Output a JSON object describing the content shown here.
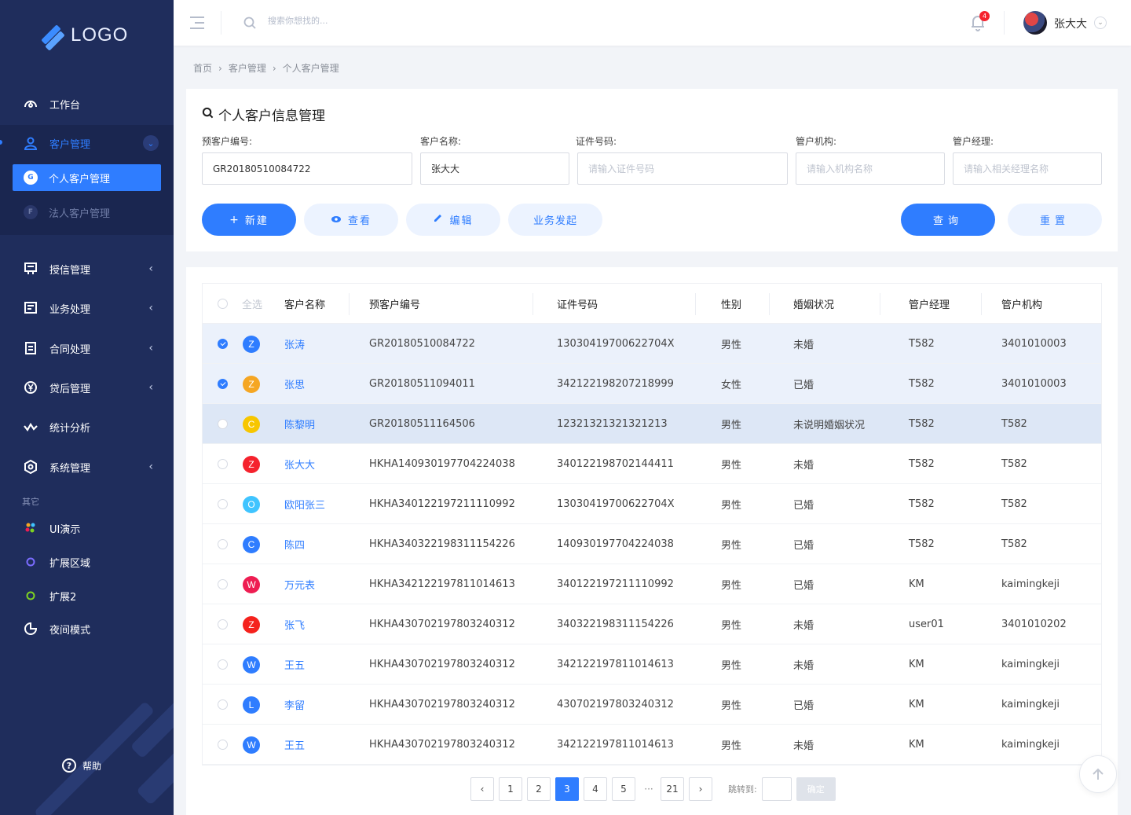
{
  "sidebar": {
    "logo": "LOGO",
    "menu": [
      {
        "label": "工作台",
        "icon": "dashboard-icon",
        "arrow": false
      },
      {
        "label": "客户管理",
        "icon": "user-icon",
        "arrow": "down"
      },
      {
        "label": "授信管理",
        "icon": "credit-icon",
        "arrow": "left"
      },
      {
        "label": "业务处理",
        "icon": "business-icon",
        "arrow": "left"
      },
      {
        "label": "合同处理",
        "icon": "contract-icon",
        "arrow": "left"
      },
      {
        "label": "贷后管理",
        "icon": "yen-icon",
        "arrow": "left"
      },
      {
        "label": "统计分析",
        "icon": "chart-icon",
        "arrow": false
      },
      {
        "label": "系统管理",
        "icon": "settings-icon",
        "arrow": "left"
      }
    ],
    "submenu": [
      {
        "badge": "G",
        "label": "个人客户管理",
        "active": true
      },
      {
        "badge": "F",
        "label": "法人客户管理",
        "active": false
      }
    ],
    "section_label": "其它",
    "other_items": [
      {
        "label": "UI演示",
        "icon": "palette-icon"
      },
      {
        "label": "扩展区域",
        "icon": "circle-icon-purple"
      },
      {
        "label": "扩展2",
        "icon": "circle-icon-green"
      },
      {
        "label": "夜间模式",
        "icon": "moon-icon"
      }
    ],
    "help": "帮助"
  },
  "topbar": {
    "search_placeholder": "搜索你想找的...",
    "notification_count": "4",
    "user_name": "张大大"
  },
  "breadcrumb": [
    "首页",
    "客户管理",
    "个人客户管理"
  ],
  "search_panel": {
    "title": "个人客户信息管理",
    "fields": [
      {
        "label": "预客户编号:",
        "value": "GR20180510084722",
        "placeholder": ""
      },
      {
        "label": "客户名称:",
        "value": "张大大",
        "placeholder": ""
      },
      {
        "label": "证件号码:",
        "value": "",
        "placeholder": "请输入证件号码"
      },
      {
        "label": "管户机构:",
        "value": "",
        "placeholder": "请输入机构名称"
      },
      {
        "label": "管户经理:",
        "value": "",
        "placeholder": "请输入相关经理名称"
      }
    ],
    "buttons": {
      "new": "新建",
      "view": "查看",
      "edit": "编辑",
      "business": "业务发起",
      "query": "查询",
      "reset": "重置"
    }
  },
  "table": {
    "columns": [
      "全选",
      "客户名称",
      "预客户编号",
      "证件号码",
      "性别",
      "婚姻状况",
      "管户经理",
      "管户机构"
    ],
    "rows": [
      {
        "checked": true,
        "state": "sel",
        "initial": "Z",
        "color": "#2f7dff",
        "name": "张涛",
        "pre_id": "GR20180510084722",
        "cert": "13030419700622704X",
        "gender": "男性",
        "marital": "未婚",
        "manager": "T582",
        "org": "3401010003"
      },
      {
        "checked": true,
        "state": "sel",
        "initial": "Z",
        "color": "#f5a623",
        "name": "张思",
        "pre_id": "GR20180511094011",
        "cert": "342122198207218999",
        "gender": "女性",
        "marital": "已婚",
        "manager": "T582",
        "org": "3401010003"
      },
      {
        "checked": false,
        "state": "hl",
        "initial": "C",
        "color": "#f7c600",
        "name": "陈黎明",
        "pre_id": "GR20180511164506",
        "cert": "12321321321321213",
        "gender": "男性",
        "marital": "未说明婚姻状况",
        "manager": "T582",
        "org": "T582"
      },
      {
        "checked": false,
        "state": "",
        "initial": "Z",
        "color": "#f5222d",
        "name": "张大大",
        "pre_id": "HKHA140930197704224038",
        "cert": "340122198702144411",
        "gender": "男性",
        "marital": "未婚",
        "manager": "T582",
        "org": "T582"
      },
      {
        "checked": false,
        "state": "",
        "initial": "O",
        "color": "#40c4ff",
        "name": "欧阳张三",
        "pre_id": "HKHA340122197211110992",
        "cert": "13030419700622704X",
        "gender": "男性",
        "marital": "已婚",
        "manager": "T582",
        "org": "T582"
      },
      {
        "checked": false,
        "state": "",
        "initial": "C",
        "color": "#2f7dff",
        "name": "陈四",
        "pre_id": "HKHA340322198311154226",
        "cert": "140930197704224038",
        "gender": "男性",
        "marital": "已婚",
        "manager": "T582",
        "org": "T582"
      },
      {
        "checked": false,
        "state": "",
        "initial": "W",
        "color": "#ee1d52",
        "name": "万元表",
        "pre_id": "HKHA342122197811014613",
        "cert": "340122197211110992",
        "gender": "男性",
        "marital": "已婚",
        "manager": "KM",
        "org": "kaimingkeji"
      },
      {
        "checked": false,
        "state": "",
        "initial": "Z",
        "color": "#f5221d",
        "name": "张飞",
        "pre_id": "HKHA430702197803240312",
        "cert": "340322198311154226",
        "gender": "男性",
        "marital": "未婚",
        "manager": "user01",
        "org": "3401010202"
      },
      {
        "checked": false,
        "state": "",
        "initial": "W",
        "color": "#2f7dff",
        "name": "王五",
        "pre_id": "HKHA430702197803240312",
        "cert": "342122197811014613",
        "gender": "男性",
        "marital": "未婚",
        "manager": "KM",
        "org": "kaimingkeji"
      },
      {
        "checked": false,
        "state": "",
        "initial": "L",
        "color": "#2f7dff",
        "name": "李留",
        "pre_id": "HKHA430702197803240312",
        "cert": "430702197803240312",
        "gender": "男性",
        "marital": "已婚",
        "manager": "KM",
        "org": "kaimingkeji"
      },
      {
        "checked": false,
        "state": "",
        "initial": "W",
        "color": "#2f7dff",
        "name": "王五",
        "pre_id": "HKHA430702197803240312",
        "cert": "342122197811014613",
        "gender": "男性",
        "marital": "未婚",
        "manager": "KM",
        "org": "kaimingkeji"
      }
    ]
  },
  "pagination": {
    "pages": [
      "1",
      "2",
      "3",
      "4",
      "5"
    ],
    "current": "3",
    "last": "21",
    "ellipsis": "···",
    "jump_label": "跳转到:",
    "confirm": "确定"
  },
  "colors": {
    "primary": "#2f7dff",
    "sidebar": "#1f2d5c"
  }
}
